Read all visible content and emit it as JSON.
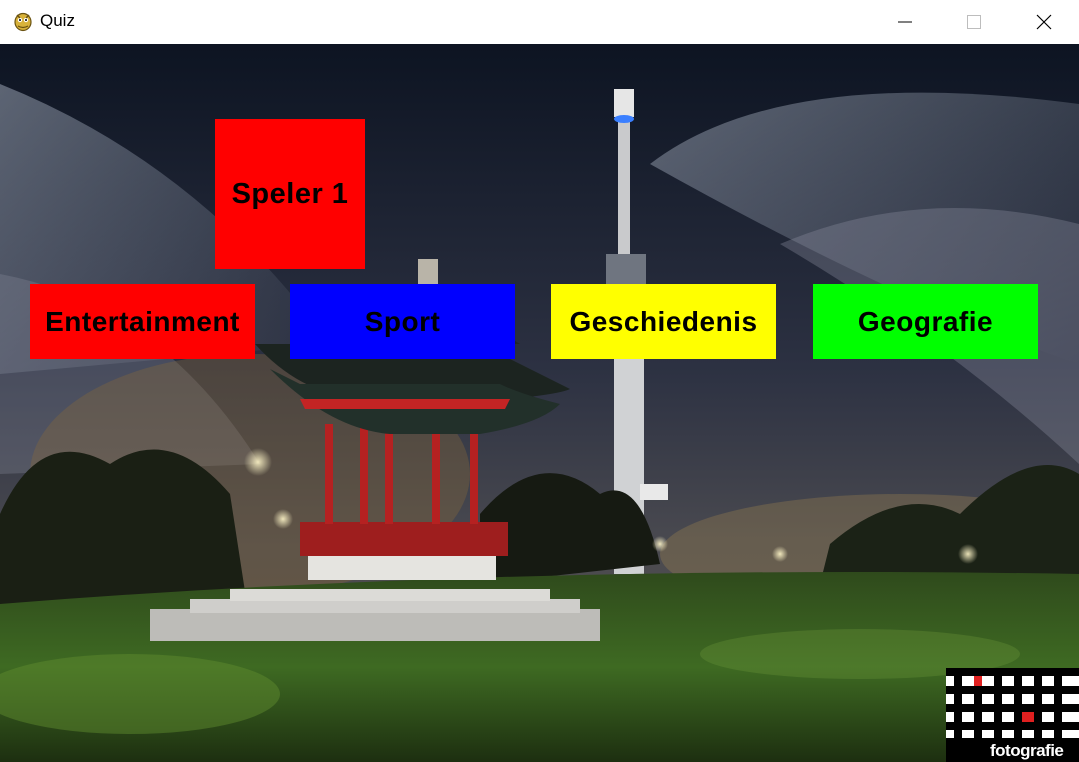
{
  "window": {
    "title": "Quiz",
    "app_icon": "pygame-snake-icon",
    "controls": [
      "minimize-icon",
      "maximize-icon",
      "close-icon"
    ]
  },
  "player": {
    "label": "Speler 1",
    "color": "#ff0000"
  },
  "categories": [
    {
      "label": "Entertainment",
      "color": "#ff0000"
    },
    {
      "label": "Sport",
      "color": "#0000ff"
    },
    {
      "label": "Geschiedenis",
      "color": "#ffff00"
    },
    {
      "label": "Geografie",
      "color": "#00ff00"
    }
  ],
  "background": {
    "description_icon": "night-park-pagoda-tower-photo"
  },
  "watermark": {
    "text": "fotografie"
  }
}
